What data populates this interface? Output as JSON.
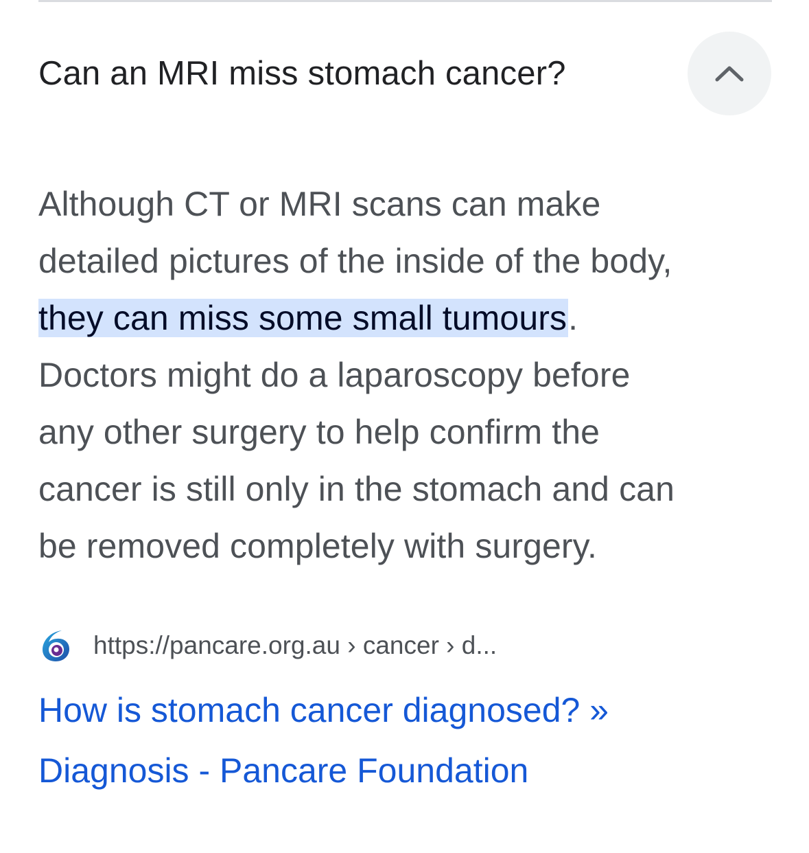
{
  "question": {
    "text": "Can an MRI miss stomach cancer?",
    "toggle_icon": "chevron-up-icon"
  },
  "answer": {
    "line1": "Although CT or MRI scans can make",
    "line2": "detailed pictures of the inside of the body,",
    "highlight": "they can miss some small tumours",
    "highlight_tail": ".",
    "line4": "Doctors might do a laparoscopy before",
    "line5": "any other surgery to help confirm the",
    "line6": "cancer is still only in the stomach and can",
    "line7": "be removed completely with surgery."
  },
  "source": {
    "favicon": "pancare-logo-icon",
    "url": "https://pancare.org.au › cancer › d..."
  },
  "result": {
    "title_line1": "How is stomach cancer diagnosed? »",
    "title_line2": "Diagnosis - Pancare Foundation"
  },
  "colors": {
    "highlight_bg": "#d3e3fd",
    "link": "#1558d6",
    "body_text": "#4d5156",
    "heading_text": "#202124",
    "button_bg": "#f1f3f4"
  }
}
